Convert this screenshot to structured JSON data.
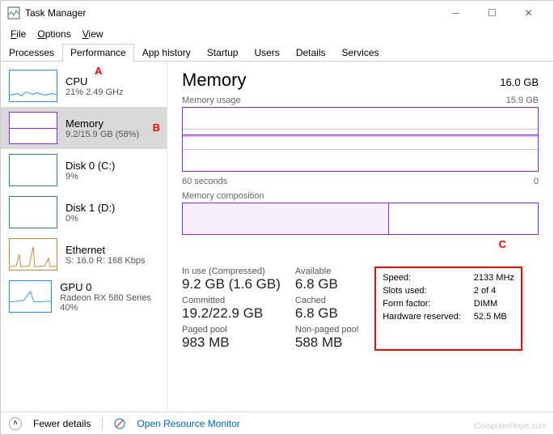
{
  "window": {
    "title": "Task Manager"
  },
  "menu": {
    "file": "File",
    "options": "Options",
    "view": "View"
  },
  "tabs": [
    "Processes",
    "Performance",
    "App history",
    "Startup",
    "Users",
    "Details",
    "Services"
  ],
  "active_tab": 1,
  "annotations": {
    "a": "A",
    "b": "B",
    "c": "C"
  },
  "sidebar": [
    {
      "name": "CPU",
      "sub": "21% 2.49 GHz",
      "color": "#1e90ff",
      "type": "cpu"
    },
    {
      "name": "Memory",
      "sub": "9.2/15.9 GB (58%)",
      "color": "#8a2be2",
      "type": "mem",
      "selected": true
    },
    {
      "name": "Disk 0 (C:)",
      "sub": "9%",
      "color": "#2e8b57",
      "type": "disk"
    },
    {
      "name": "Disk 1 (D:)",
      "sub": "0%",
      "color": "#2e8b57",
      "type": "disk"
    },
    {
      "name": "Ethernet",
      "sub": "S: 16.0  R: 168 Kbps",
      "color": "#cd853f",
      "type": "eth"
    },
    {
      "name": "GPU 0",
      "sub": "Radeon RX 580 Series\n40%",
      "color": "#1e90ff",
      "type": "gpu"
    }
  ],
  "main": {
    "title": "Memory",
    "total": "16.0 GB",
    "usage_label": "Memory usage",
    "usage_max": "15.9 GB",
    "time_left": "60 seconds",
    "time_right": "0",
    "comp_label": "Memory composition",
    "stats": [
      {
        "lbl": "In use (Compressed)",
        "val": "9.2 GB (1.6 GB)"
      },
      {
        "lbl": "Available",
        "val": "6.8 GB"
      },
      {
        "lbl": "Committed",
        "val": "19.2/22.9 GB"
      },
      {
        "lbl": "Cached",
        "val": "6.8 GB"
      },
      {
        "lbl": "Paged pool",
        "val": "983 MB"
      },
      {
        "lbl": "Non-paged pool",
        "val": "588 MB"
      }
    ],
    "specs": [
      {
        "k": "Speed:",
        "v": "2133 MHz"
      },
      {
        "k": "Slots used:",
        "v": "2 of 4"
      },
      {
        "k": "Form factor:",
        "v": "DIMM"
      },
      {
        "k": "Hardware reserved:",
        "v": "52.5 MB"
      }
    ]
  },
  "footer": {
    "fewer": "Fewer details",
    "orm": "Open Resource Monitor"
  },
  "watermark": "ComputerHope.com",
  "chart_data": {
    "type": "line",
    "title": "Memory usage",
    "xlabel": "seconds",
    "ylabel": "GB",
    "x_range": [
      60,
      0
    ],
    "ylim": [
      0,
      15.9
    ],
    "series": [
      {
        "name": "Memory",
        "values_approx_constant": 9.2
      }
    ],
    "composition": {
      "in_use_gb": 9.2,
      "total_gb": 15.9
    }
  }
}
